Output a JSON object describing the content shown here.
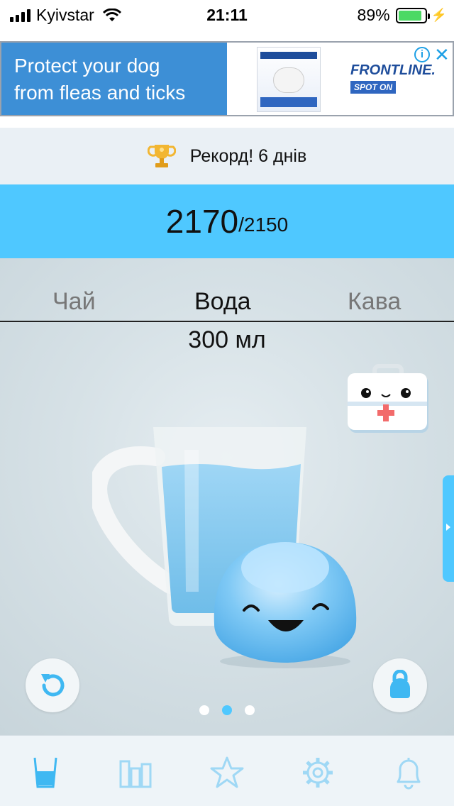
{
  "status_bar": {
    "carrier": "Kyivstar",
    "time": "21:11",
    "battery_percent": "89%",
    "battery_level": 0.89,
    "battery_color": "#4cd964"
  },
  "ad": {
    "headline_line1": "Protect your dog",
    "headline_line2": "from fleas and ticks",
    "brand": "FRONTLINE.",
    "badge": "SPOT ON",
    "info_icon": "info-icon",
    "close_icon": "close-icon",
    "background_color": "#3d8fd6"
  },
  "record": {
    "icon": "trophy-icon",
    "text": "Рекорд! 6 днів"
  },
  "progress": {
    "current": "2170",
    "goal": "/2150",
    "fraction": 1.0,
    "fill_color": "#4fc8ff"
  },
  "drink_tabs": [
    {
      "label": "Чай",
      "selected": false
    },
    {
      "label": "Вода",
      "selected": true
    },
    {
      "label": "Кава",
      "selected": false
    }
  ],
  "amount": "300 мл",
  "pager": {
    "pages": 3,
    "active_index": 1
  },
  "bottom_nav": [
    {
      "icon": "glass-icon",
      "active": true
    },
    {
      "icon": "bar-chart-icon",
      "active": false
    },
    {
      "icon": "star-icon",
      "active": false
    },
    {
      "icon": "gear-icon",
      "active": false
    },
    {
      "icon": "bell-icon",
      "active": false
    }
  ],
  "accent_color": "#4fc8ff"
}
